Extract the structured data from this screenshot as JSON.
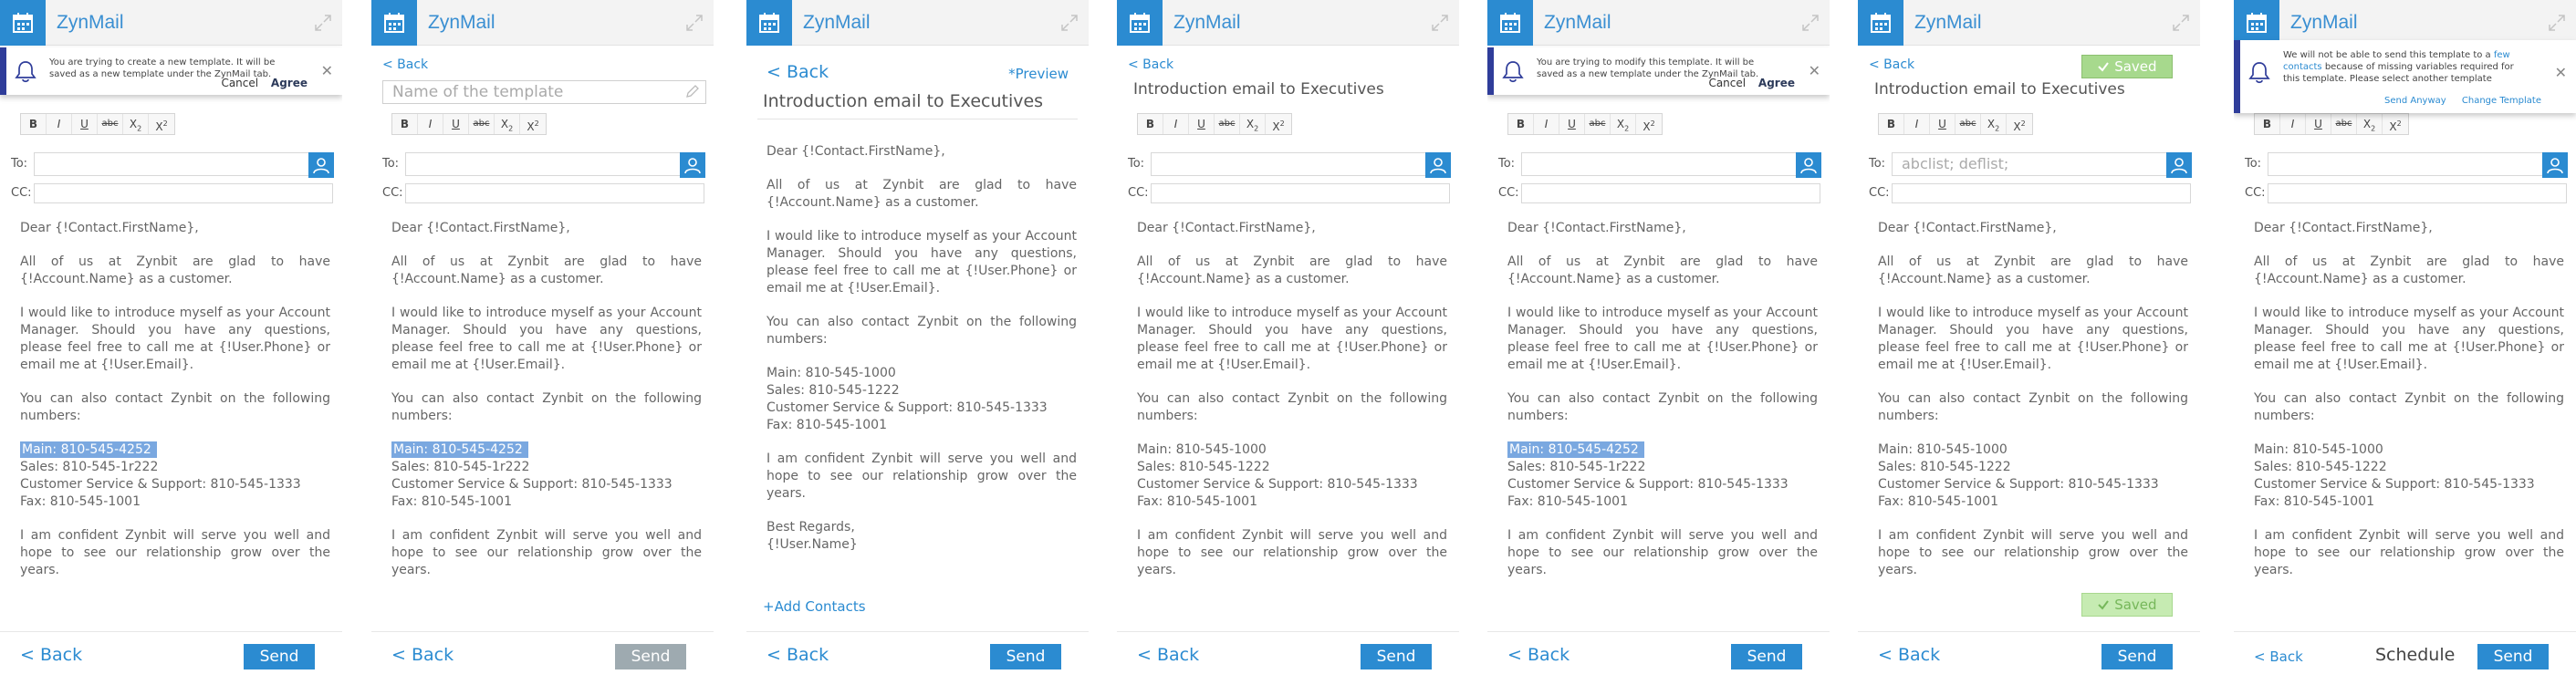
{
  "app": {
    "name": "ZynMail"
  },
  "colors": {
    "accent": "#2b8bd1",
    "notification_border": "#2f3d9a",
    "saved": "#a7d98d",
    "highlight": "#7aa8e0"
  },
  "icons": {
    "app": "calendar-icon",
    "expand": "expand-arrows-icon",
    "notif": "bell-icon",
    "contact": "person-icon",
    "edit": "pencil-icon",
    "close": "close-icon",
    "check": "checkmark-icon"
  },
  "email": {
    "title": "Introduction email to Executives",
    "greeting": "Dear {!Contact.FirstName},",
    "para1": "All of us at Zynbit are glad to have {!Account.Name} as a customer.",
    "para2": "I would like to introduce myself as your Account Manager. Should you have any questions, please feel free to call me at {!User.Phone} or email me at {!User.Email}.",
    "para3": "You can also contact Zynbit on the following numbers:",
    "main_a": "Main: 810-545-4252",
    "main_b": "Main: 810-545-1000",
    "sales_a": "Sales: 810-545-1r222",
    "sales_b": "Sales: 810-545-1222",
    "support": "Customer Service & Support: 810-545-1333",
    "fax": "Fax: 810-545-1001",
    "para4": "I am confident Zynbit will serve you well and hope to see our relationship grow over the years.",
    "sign1": "Best Regards,",
    "sign2": "{!User.Name}"
  },
  "toolbar": {
    "bold": "B",
    "italic": "I",
    "underline": "U",
    "strike": "abc",
    "subscript": "X",
    "superscript": "X",
    "sub_mark": "2",
    "sup_mark": "2"
  },
  "fields": {
    "to_label": "To:",
    "cc_label": "CC:",
    "to_value_6": "abclist; deflist;"
  },
  "template_name_placeholder": "Name of the template",
  "nav": {
    "back": "Back",
    "back_link": "< Back",
    "preview": "*Preview",
    "add_contacts": "+Add Contacts"
  },
  "buttons": {
    "send": "Send",
    "schedule": "Schedule",
    "saved": "Saved",
    "cancel": "Cancel",
    "agree": "Agree"
  },
  "notifications": {
    "create": "You are trying to create a new template. It will be saved as a new template under the ZynMail tab.",
    "modify": "You are trying to modify this template. It will be saved as a new template under the ZynMail tab.",
    "missing_a": "We will not be able to send this template to a",
    "missing_link": "few contacts",
    "missing_b": "because of missing variables required for this template. Please select another template",
    "send_anyway": "Send Anyway",
    "change_template": "Change Template"
  }
}
